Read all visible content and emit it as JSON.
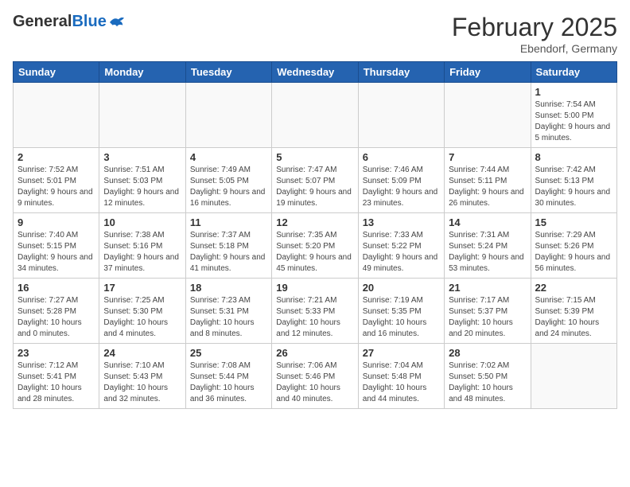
{
  "header": {
    "logo_general": "General",
    "logo_blue": "Blue",
    "month_year": "February 2025",
    "location": "Ebendorf, Germany"
  },
  "days_of_week": [
    "Sunday",
    "Monday",
    "Tuesday",
    "Wednesday",
    "Thursday",
    "Friday",
    "Saturday"
  ],
  "weeks": [
    [
      {
        "day": "",
        "info": ""
      },
      {
        "day": "",
        "info": ""
      },
      {
        "day": "",
        "info": ""
      },
      {
        "day": "",
        "info": ""
      },
      {
        "day": "",
        "info": ""
      },
      {
        "day": "",
        "info": ""
      },
      {
        "day": "1",
        "info": "Sunrise: 7:54 AM\nSunset: 5:00 PM\nDaylight: 9 hours and 5 minutes."
      }
    ],
    [
      {
        "day": "2",
        "info": "Sunrise: 7:52 AM\nSunset: 5:01 PM\nDaylight: 9 hours and 9 minutes."
      },
      {
        "day": "3",
        "info": "Sunrise: 7:51 AM\nSunset: 5:03 PM\nDaylight: 9 hours and 12 minutes."
      },
      {
        "day": "4",
        "info": "Sunrise: 7:49 AM\nSunset: 5:05 PM\nDaylight: 9 hours and 16 minutes."
      },
      {
        "day": "5",
        "info": "Sunrise: 7:47 AM\nSunset: 5:07 PM\nDaylight: 9 hours and 19 minutes."
      },
      {
        "day": "6",
        "info": "Sunrise: 7:46 AM\nSunset: 5:09 PM\nDaylight: 9 hours and 23 minutes."
      },
      {
        "day": "7",
        "info": "Sunrise: 7:44 AM\nSunset: 5:11 PM\nDaylight: 9 hours and 26 minutes."
      },
      {
        "day": "8",
        "info": "Sunrise: 7:42 AM\nSunset: 5:13 PM\nDaylight: 9 hours and 30 minutes."
      }
    ],
    [
      {
        "day": "9",
        "info": "Sunrise: 7:40 AM\nSunset: 5:15 PM\nDaylight: 9 hours and 34 minutes."
      },
      {
        "day": "10",
        "info": "Sunrise: 7:38 AM\nSunset: 5:16 PM\nDaylight: 9 hours and 37 minutes."
      },
      {
        "day": "11",
        "info": "Sunrise: 7:37 AM\nSunset: 5:18 PM\nDaylight: 9 hours and 41 minutes."
      },
      {
        "day": "12",
        "info": "Sunrise: 7:35 AM\nSunset: 5:20 PM\nDaylight: 9 hours and 45 minutes."
      },
      {
        "day": "13",
        "info": "Sunrise: 7:33 AM\nSunset: 5:22 PM\nDaylight: 9 hours and 49 minutes."
      },
      {
        "day": "14",
        "info": "Sunrise: 7:31 AM\nSunset: 5:24 PM\nDaylight: 9 hours and 53 minutes."
      },
      {
        "day": "15",
        "info": "Sunrise: 7:29 AM\nSunset: 5:26 PM\nDaylight: 9 hours and 56 minutes."
      }
    ],
    [
      {
        "day": "16",
        "info": "Sunrise: 7:27 AM\nSunset: 5:28 PM\nDaylight: 10 hours and 0 minutes."
      },
      {
        "day": "17",
        "info": "Sunrise: 7:25 AM\nSunset: 5:30 PM\nDaylight: 10 hours and 4 minutes."
      },
      {
        "day": "18",
        "info": "Sunrise: 7:23 AM\nSunset: 5:31 PM\nDaylight: 10 hours and 8 minutes."
      },
      {
        "day": "19",
        "info": "Sunrise: 7:21 AM\nSunset: 5:33 PM\nDaylight: 10 hours and 12 minutes."
      },
      {
        "day": "20",
        "info": "Sunrise: 7:19 AM\nSunset: 5:35 PM\nDaylight: 10 hours and 16 minutes."
      },
      {
        "day": "21",
        "info": "Sunrise: 7:17 AM\nSunset: 5:37 PM\nDaylight: 10 hours and 20 minutes."
      },
      {
        "day": "22",
        "info": "Sunrise: 7:15 AM\nSunset: 5:39 PM\nDaylight: 10 hours and 24 minutes."
      }
    ],
    [
      {
        "day": "23",
        "info": "Sunrise: 7:12 AM\nSunset: 5:41 PM\nDaylight: 10 hours and 28 minutes."
      },
      {
        "day": "24",
        "info": "Sunrise: 7:10 AM\nSunset: 5:43 PM\nDaylight: 10 hours and 32 minutes."
      },
      {
        "day": "25",
        "info": "Sunrise: 7:08 AM\nSunset: 5:44 PM\nDaylight: 10 hours and 36 minutes."
      },
      {
        "day": "26",
        "info": "Sunrise: 7:06 AM\nSunset: 5:46 PM\nDaylight: 10 hours and 40 minutes."
      },
      {
        "day": "27",
        "info": "Sunrise: 7:04 AM\nSunset: 5:48 PM\nDaylight: 10 hours and 44 minutes."
      },
      {
        "day": "28",
        "info": "Sunrise: 7:02 AM\nSunset: 5:50 PM\nDaylight: 10 hours and 48 minutes."
      },
      {
        "day": "",
        "info": ""
      }
    ]
  ]
}
